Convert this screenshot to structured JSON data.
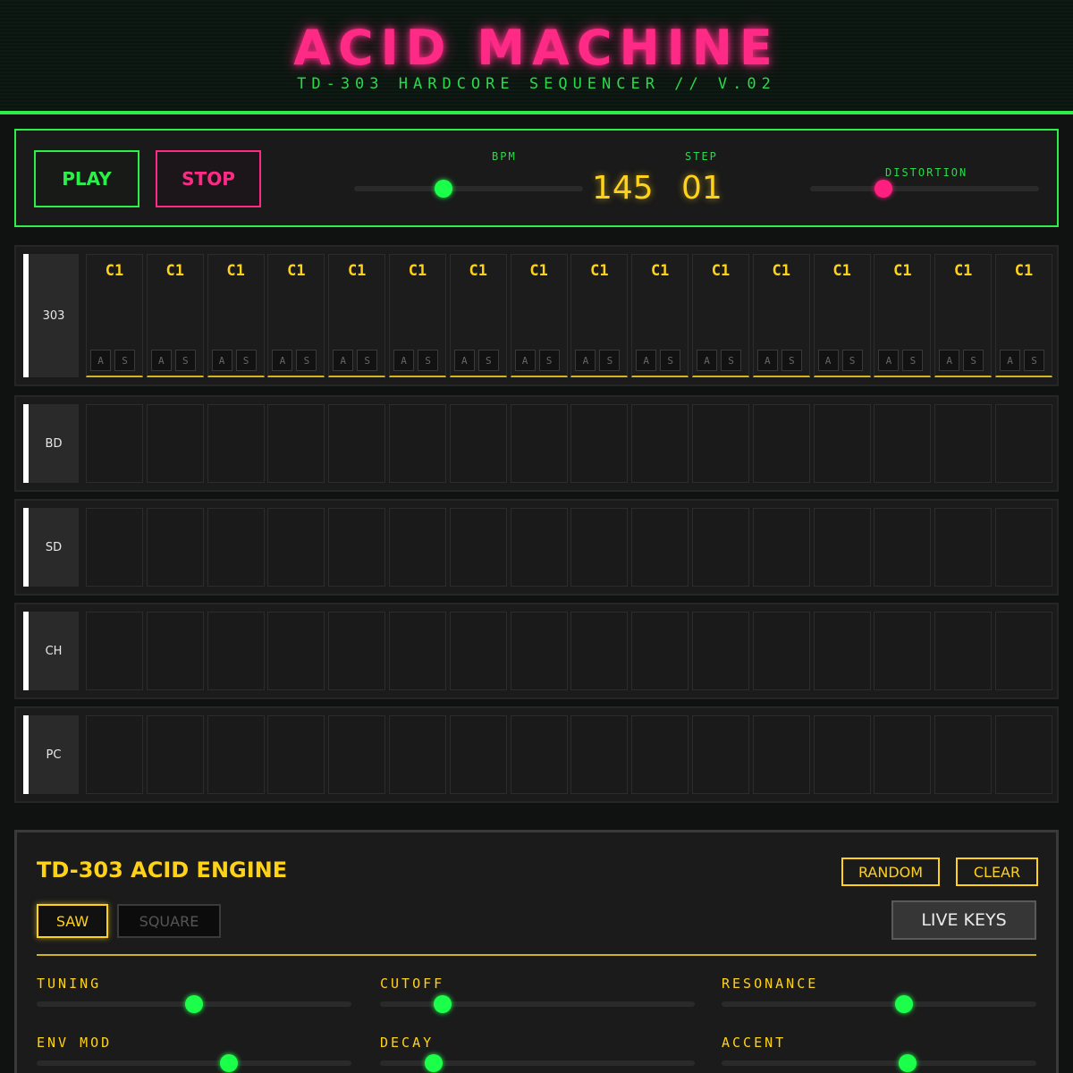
{
  "header": {
    "title": "ACID MACHINE",
    "subtitle": "TD-303 HARDCORE SEQUENCER // V.02"
  },
  "transport": {
    "play_label": "PLAY",
    "stop_label": "STOP",
    "bpm_label": "BPM",
    "bpm_value": "145",
    "step_label": "STEP",
    "step_value": "01",
    "distortion_label": "DISTORTION",
    "bpm_slider_level": 0.39,
    "distortion_slider_level": 0.32
  },
  "sequencer": {
    "steps_per_row": 16,
    "acid_row": {
      "label": "303",
      "note": "C1",
      "accent_label": "A",
      "slide_label": "S"
    },
    "drum_rows": [
      {
        "label": "BD"
      },
      {
        "label": "SD"
      },
      {
        "label": "CH"
      },
      {
        "label": "PC"
      }
    ]
  },
  "engine": {
    "title": "TD-303 ACID ENGINE",
    "random_label": "RANDOM",
    "clear_label": "CLEAR",
    "saw_label": "SAW",
    "square_label": "SQUARE",
    "live_keys_label": "LIVE KEYS",
    "selected_waveform": "SAW",
    "params": [
      {
        "label": "TUNING",
        "level": 0.5
      },
      {
        "label": "CUTOFF",
        "level": 0.2
      },
      {
        "label": "RESONANCE",
        "level": 0.58
      },
      {
        "label": "ENV MOD",
        "level": 0.61
      },
      {
        "label": "DECAY",
        "level": 0.17
      },
      {
        "label": "ACCENT",
        "level": 0.59
      }
    ]
  },
  "colors": {
    "green": "#2bf04a",
    "pink": "#ff2a86",
    "yellow": "#ffd21a"
  }
}
